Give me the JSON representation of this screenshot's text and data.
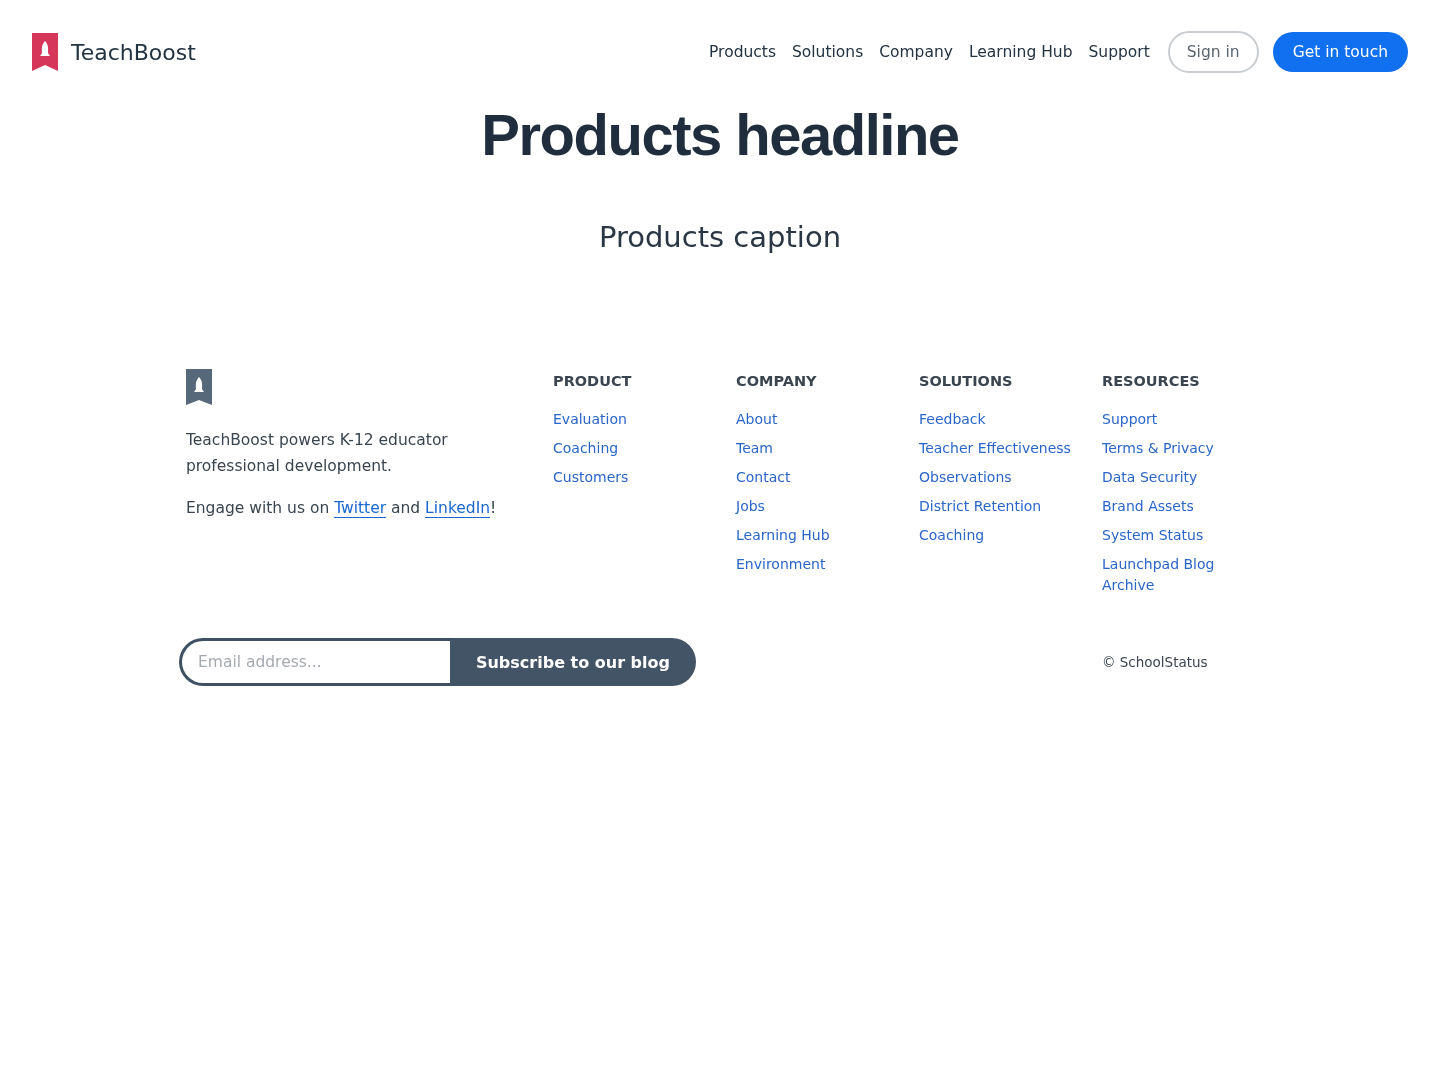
{
  "header": {
    "brand": "TeachBoost",
    "nav": [
      "Products",
      "Solutions",
      "Company",
      "Learning Hub",
      "Support"
    ],
    "sign_in": "Sign in",
    "cta": "Get in touch"
  },
  "hero": {
    "headline": "Products headline",
    "caption": "Products caption"
  },
  "footer": {
    "about": "TeachBoost powers K-12 educator professional development.",
    "engage": {
      "before": "Engage with us on",
      "links": [
        "Twitter",
        "LinkedIn"
      ],
      "between": "and",
      "after": "!"
    },
    "columns": [
      {
        "title": "PRODUCT",
        "links": [
          "Evaluation",
          "Coaching",
          "Customers"
        ]
      },
      {
        "title": "COMPANY",
        "links": [
          "About",
          "Team",
          "Contact",
          "Jobs",
          "Learning Hub",
          "Environment"
        ]
      },
      {
        "title": "SOLUTIONS",
        "links": [
          "Feedback",
          "Teacher Effectiveness",
          "Observations",
          "District Retention",
          "Coaching"
        ]
      },
      {
        "title": "RESOURCES",
        "links": [
          "Support",
          "Terms & Privacy",
          "Data Security",
          "Brand Assets",
          "System Status",
          "Launchpad Blog Archive"
        ]
      }
    ],
    "subscribe": {
      "placeholder": "Email address...",
      "button": "Subscribe to our blog"
    },
    "copyright": "© SchoolStatus"
  }
}
